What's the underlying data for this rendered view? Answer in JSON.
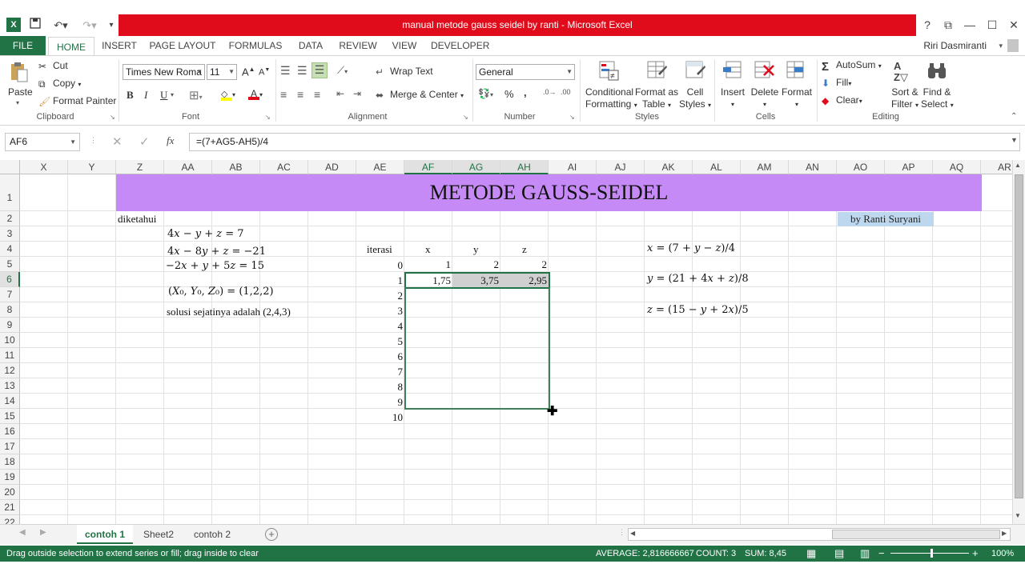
{
  "window": {
    "title": "manual metode gauss seidel by ranti - Microsoft Excel",
    "app_icon": "X",
    "controls": [
      "?",
      "⧉",
      "—",
      "☐",
      "✕"
    ]
  },
  "tabs": [
    "FILE",
    "HOME",
    "INSERT",
    "PAGE LAYOUT",
    "FORMULAS",
    "DATA",
    "REVIEW",
    "VIEW",
    "DEVELOPER"
  ],
  "user": "Riri Dasmiranti",
  "ribbon": {
    "clipboard": {
      "paste": "Paste",
      "cut": "Cut",
      "copy": "Copy",
      "format_painter": "Format Painter",
      "label": "Clipboard"
    },
    "font": {
      "family": "Times New Roma",
      "size": "11",
      "bold": "B",
      "italic": "I",
      "underline": "U",
      "label": "Font"
    },
    "alignment": {
      "wrap": "Wrap Text",
      "merge": "Merge & Center",
      "label": "Alignment"
    },
    "number": {
      "format": "General",
      "percent": "%",
      "comma": ",",
      "label": "Number"
    },
    "styles": {
      "conditional": [
        "Conditional",
        "Formatting"
      ],
      "format_table": [
        "Format as",
        "Table"
      ],
      "cell_styles": [
        "Cell",
        "Styles"
      ],
      "label": "Styles"
    },
    "cells": {
      "insert": "Insert",
      "delete": "Delete",
      "format": "Format",
      "label": "Cells"
    },
    "editing": {
      "autosum": "AutoSum",
      "fill": "Fill",
      "clear": "Clear",
      "sort": [
        "Sort &",
        "Filter"
      ],
      "find": [
        "Find &",
        "Select"
      ],
      "label": "Editing"
    }
  },
  "formula_bar": {
    "name_box": "AF6",
    "formula": "=(7+AG5-AH5)/4"
  },
  "columns": [
    "X",
    "Y",
    "Z",
    "AA",
    "AB",
    "AC",
    "AD",
    "AE",
    "AF",
    "AG",
    "AH",
    "AI",
    "AJ",
    "AK",
    "AL",
    "AM",
    "AN",
    "AO",
    "AP",
    "AQ",
    "AR"
  ],
  "rows": [
    "1",
    "2",
    "3",
    "4",
    "5",
    "6",
    "7",
    "8",
    "9",
    "10",
    "11",
    "12",
    "13",
    "14",
    "15",
    "16",
    "17",
    "18",
    "19",
    "20",
    "21",
    "22"
  ],
  "sheet": {
    "title": "METODE GAUSS-SEIDEL",
    "byline": "by Ranti Suryani",
    "diketahui": "diketahui",
    "eq1": "4𝑥 − 𝑦 + 𝑧 = 7",
    "eq2": "4𝑥 − 8𝑦 + 𝑧 = −21",
    "eq3": "−2𝑥 + 𝑦 + 5𝑧 = 15",
    "initial": "(𝑋₀, 𝑌₀, 𝑍₀) = (1,2,2)",
    "solution": "solusi sejatinya adalah (2,4,3)",
    "iter_header": "iterasi",
    "x_header": "x",
    "y_header": "y",
    "z_header": "z",
    "iterations": [
      "0",
      "1",
      "2",
      "3",
      "4",
      "5",
      "6",
      "7",
      "8",
      "9",
      "10"
    ],
    "row0": [
      "1",
      "2",
      "2"
    ],
    "row1": [
      "1,75",
      "3,75",
      "2,95"
    ],
    "fx": "𝑥 = (7 + 𝑦 − 𝑧)/4",
    "fy": "𝑦 = (21 + 4𝑥 + 𝑧)/8",
    "fz": "𝑧 = (15 − 𝑦 + 2𝑥)/5"
  },
  "sheet_tabs": [
    "contoh 1",
    "Sheet2",
    "contoh 2"
  ],
  "status": {
    "message": "Drag outside selection to extend series or fill; drag inside to clear",
    "average": "AVERAGE: 2,816666667",
    "count": "COUNT: 3",
    "sum": "SUM: 8,45",
    "zoom": "100%"
  },
  "colors": {
    "excel_green": "#217346",
    "title_red": "#e00b1b",
    "header_purple": "#c58af5",
    "byline_blue": "#bdd7ee"
  }
}
